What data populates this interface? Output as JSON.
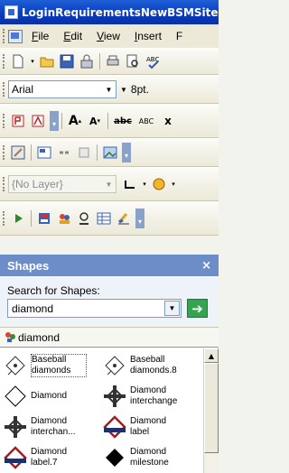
{
  "window": {
    "title": "LoginRequirementsNewBSMSite"
  },
  "menu": {
    "items": [
      "File",
      "Edit",
      "View",
      "Insert",
      "F"
    ],
    "underlines": [
      "F",
      "E",
      "V",
      "I",
      ""
    ]
  },
  "font_toolbar": {
    "font_name": "Arial",
    "font_size": "8pt."
  },
  "layer_toolbar": {
    "layer_value": "{No Layer}"
  },
  "shapes_panel": {
    "title": "Shapes",
    "close_glyph": "×",
    "search_label": "Search for Shapes:",
    "search_value": "diamond",
    "go_glyph": "➔",
    "result_tab": "diamond",
    "shapes": [
      {
        "name": "Baseball diamonds",
        "label": "Baseball\ndiamonds",
        "icon": "baseball-diamond-icon"
      },
      {
        "name": "Baseball diamonds.8",
        "label": "Baseball\ndiamonds.8",
        "icon": "baseball-diamond-icon"
      },
      {
        "name": "Diamond",
        "label": "Diamond",
        "icon": "diamond-icon"
      },
      {
        "name": "Diamond interchange",
        "label": "Diamond\ninterchange",
        "icon": "diamond-interchange-icon"
      },
      {
        "name": "Diamond interchan...",
        "label": "Diamond\ninterchan...",
        "icon": "diamond-interchange-icon"
      },
      {
        "name": "Diamond label",
        "label": "Diamond\nlabel",
        "icon": "diamond-label-icon"
      },
      {
        "name": "Diamond label.7",
        "label": "Diamond\nlabel.7",
        "icon": "diamond-label-icon"
      },
      {
        "name": "Diamond milestone",
        "label": "Diamond\nmilestone",
        "icon": "diamond-milestone-icon"
      }
    ]
  }
}
